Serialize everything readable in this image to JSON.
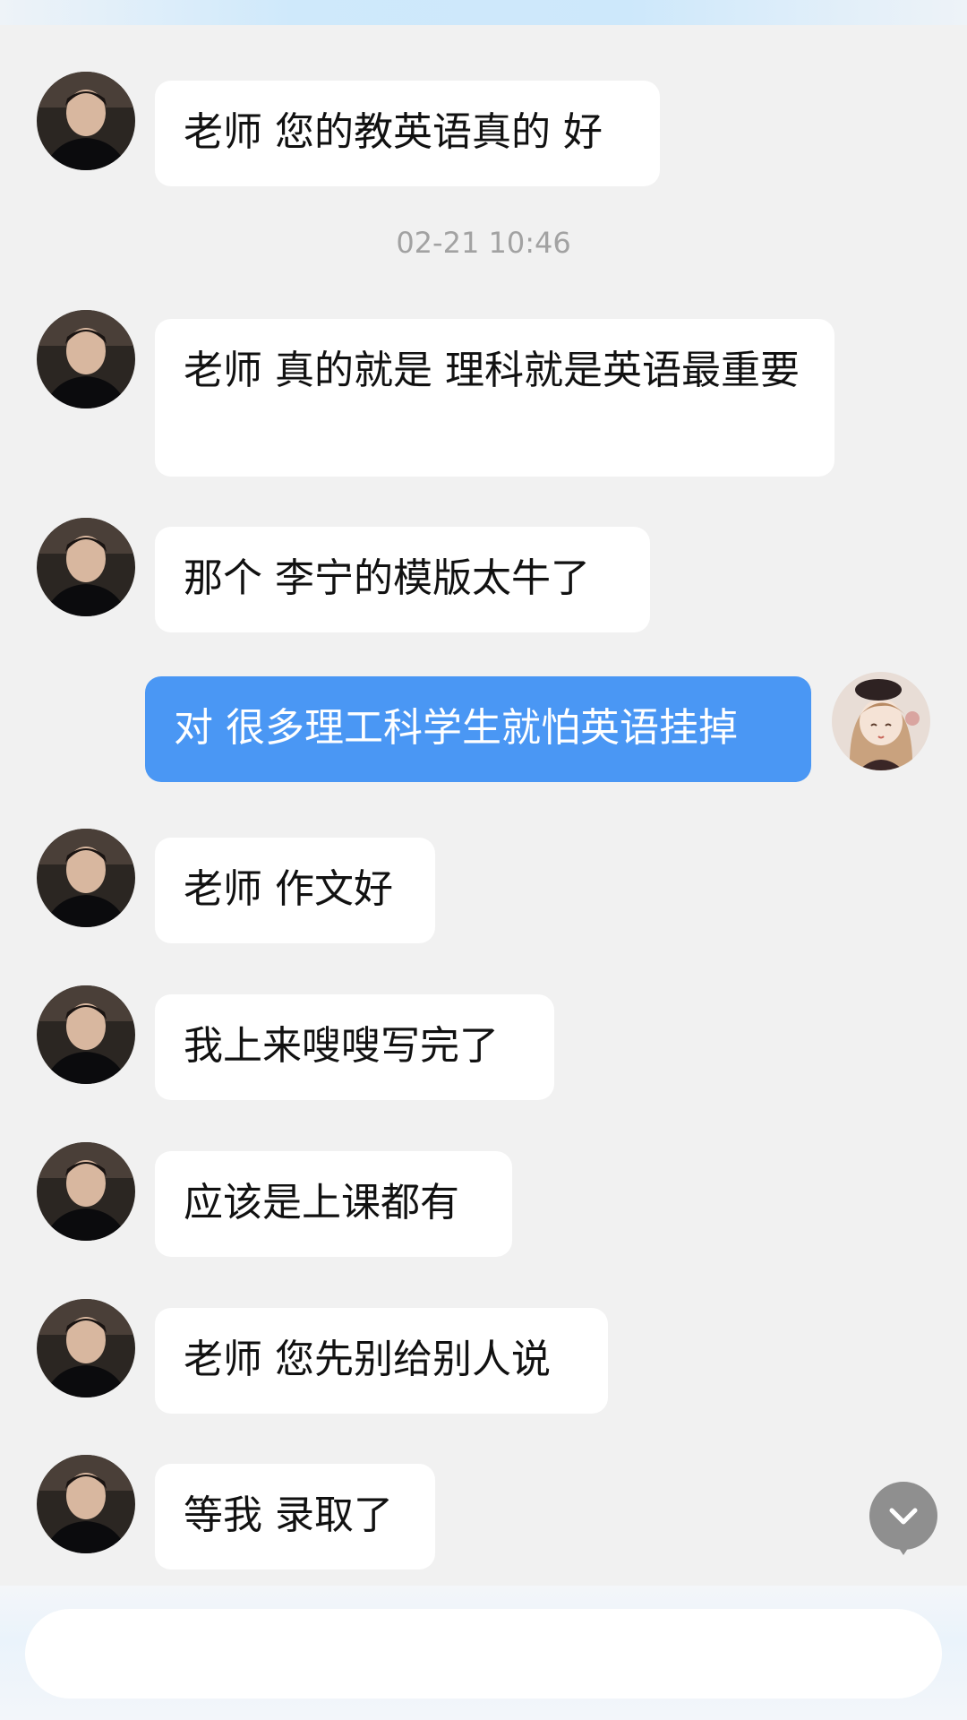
{
  "messages": [
    {
      "side": "left",
      "text": "老师 您的教英语真的 好",
      "avatar": "male-avatar"
    },
    {
      "timestamp": "02-21 10:46"
    },
    {
      "side": "left",
      "text": "老师 真的就是 理科就是英语最重要",
      "avatar": "male-avatar"
    },
    {
      "side": "left",
      "text": "那个 李宁的模版太牛了",
      "avatar": "male-avatar"
    },
    {
      "side": "right",
      "text": "对 很多理工科学生就怕英语挂掉",
      "avatar": "girl-avatar"
    },
    {
      "side": "left",
      "text": "老师 作文好",
      "avatar": "male-avatar"
    },
    {
      "side": "left",
      "text": "我上来嗖嗖写完了",
      "avatar": "male-avatar"
    },
    {
      "side": "left",
      "text": "应该是上课都有",
      "avatar": "male-avatar"
    },
    {
      "side": "left",
      "text": "老师 您先别给别人说",
      "avatar": "male-avatar"
    },
    {
      "side": "left",
      "text": "等我 录取了",
      "avatar": "male-avatar"
    }
  ],
  "input": {
    "value": "",
    "placeholder": ""
  },
  "icons": {
    "scroll": "chevron-down-icon"
  },
  "colors": {
    "background": "#f1f1f1",
    "incoming_bubble": "#ffffff",
    "outgoing_bubble": "#4a97f4",
    "timestamp": "#a2a2a2"
  }
}
